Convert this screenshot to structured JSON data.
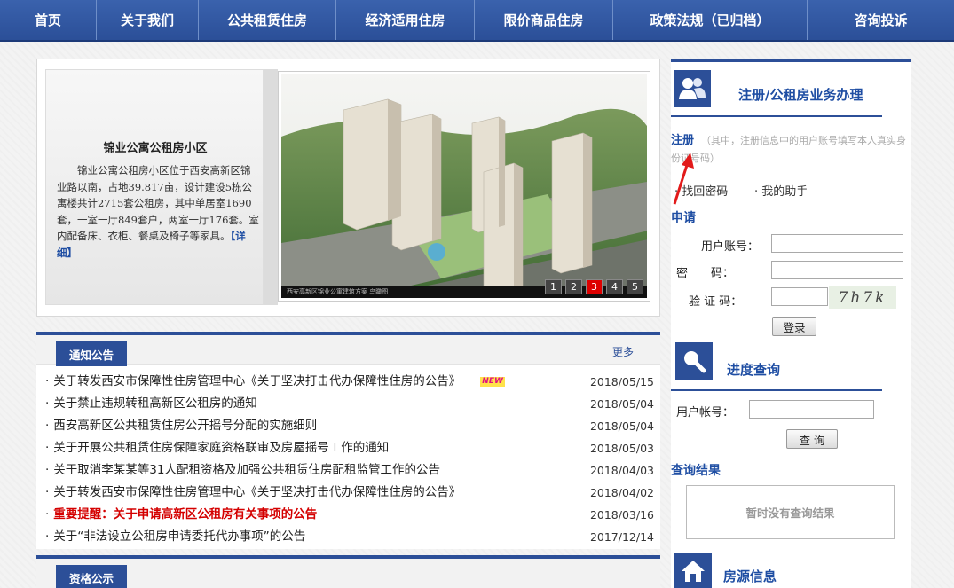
{
  "nav": {
    "items": [
      "首页",
      "关于我们",
      "公共租赁住房",
      "经济适用住房",
      "限价商品住房",
      "政策法规（已归档）",
      "咨询投诉"
    ]
  },
  "feature": {
    "title": "锦业公寓公租房小区",
    "text": "锦业公寓公租房小区位于西安高新区锦业路以南，占地39.817亩，设计建设5栋公寓楼共计2715套公租房，其中单居室1690套，一室一厅849套户，两室一厅176套。室内配备床、衣柜、餐桌及椅子等家具。",
    "more": "【详细】",
    "photo_caption": "西安高新区锦业公寓建筑方案 鸟瞰图",
    "slides": [
      "1",
      "2",
      "3",
      "4",
      "5"
    ],
    "active_slide": "3"
  },
  "notices": {
    "tab": "通知公告",
    "more": "更多",
    "new_badge": "NEW",
    "items": [
      {
        "title": "关于转发西安市保障性住房管理中心《关于坚决打击代办保障性住房的公告》",
        "date": "2018/05/15",
        "is_new": true,
        "red": false
      },
      {
        "title": "关于禁止违规转租高新区公租房的通知",
        "date": "2018/05/04",
        "is_new": false,
        "red": false
      },
      {
        "title": "西安高新区公共租赁住房公开摇号分配的实施细则",
        "date": "2018/05/04",
        "is_new": false,
        "red": false
      },
      {
        "title": "关于开展公共租赁住房保障家庭资格联审及房屋摇号工作的通知",
        "date": "2018/05/03",
        "is_new": false,
        "red": false
      },
      {
        "title": "关于取消李某某等31人配租资格及加强公共租赁住房配租监管工作的公告",
        "date": "2018/04/03",
        "is_new": false,
        "red": false
      },
      {
        "title": "关于转发西安市保障性住房管理中心《关于坚决打击代办保障性住房的公告》",
        "date": "2018/04/02",
        "is_new": false,
        "red": false
      },
      {
        "title": "重要提醒：关于申请高新区公租房有关事项的公告",
        "date": "2018/03/16",
        "is_new": false,
        "red": true
      },
      {
        "title": "关于“非法设立公租房申请委托代办事项”的公告",
        "date": "2017/12/14",
        "is_new": false,
        "red": false
      }
    ]
  },
  "qualification": {
    "tab": "资格公示"
  },
  "sidebar": {
    "register_title": "注册/公租房业务办理",
    "register_label": "注册",
    "register_note": "（其中，注册信息中的用户账号填写本人真实身份证号码）",
    "recover_password": "· 找回密码",
    "my_helper": "· 我的助手",
    "apply_label": "申请",
    "account_label": "用户账号：",
    "password_label": "密　　码：",
    "captcha_label": "验 证 码：",
    "captcha_text": "7h7k",
    "login_button": "登录",
    "progress_title": "进度查询",
    "progress_account_label": "用户帐号：",
    "query_button": "查 询",
    "result_label": "查询结果",
    "result_empty": "暂时没有查询结果",
    "housing_title": "房源信息"
  },
  "colors": {
    "nav": "#2b4f98",
    "accent": "#1f4ea3",
    "alert": "#d40000"
  }
}
